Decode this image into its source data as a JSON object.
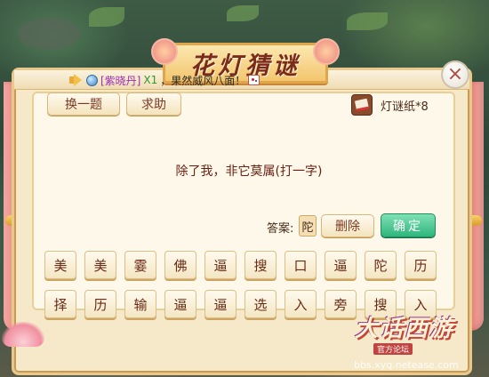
{
  "title": "花灯猜谜",
  "announcement": {
    "player_name": "[紫晓丹]",
    "count": "X1",
    "message": "，果然威风八面！"
  },
  "buttons": {
    "change": "换一题",
    "help": "求助",
    "delete": "删除",
    "confirm": "确定",
    "close": "×"
  },
  "riddle_paper": "灯谜纸*8",
  "riddle": "除了我，非它莫属(打一字)",
  "answer": {
    "label": "答案:",
    "value": "陀"
  },
  "char_rows": [
    [
      "美",
      "美",
      "霎",
      "佛",
      "逼",
      "搜",
      "口",
      "逼",
      "陀",
      "历"
    ],
    [
      "择",
      "历",
      "输",
      "逼",
      "逼",
      "选",
      "入",
      "旁",
      "搜",
      "入"
    ]
  ],
  "watermark": {
    "logo": "大话西游",
    "subtitle": "官方论坛",
    "url": "bbs.xyq.netease.com"
  },
  "colors": {
    "panel": "#f6e9c9",
    "confirm": "#2fb67d",
    "title": "#7a2b1a",
    "riddle_text": "#6b1f12"
  },
  "icons": [
    "horn-icon",
    "globe-icon",
    "dice-icon",
    "close-icon",
    "riddle-paper-icon"
  ]
}
